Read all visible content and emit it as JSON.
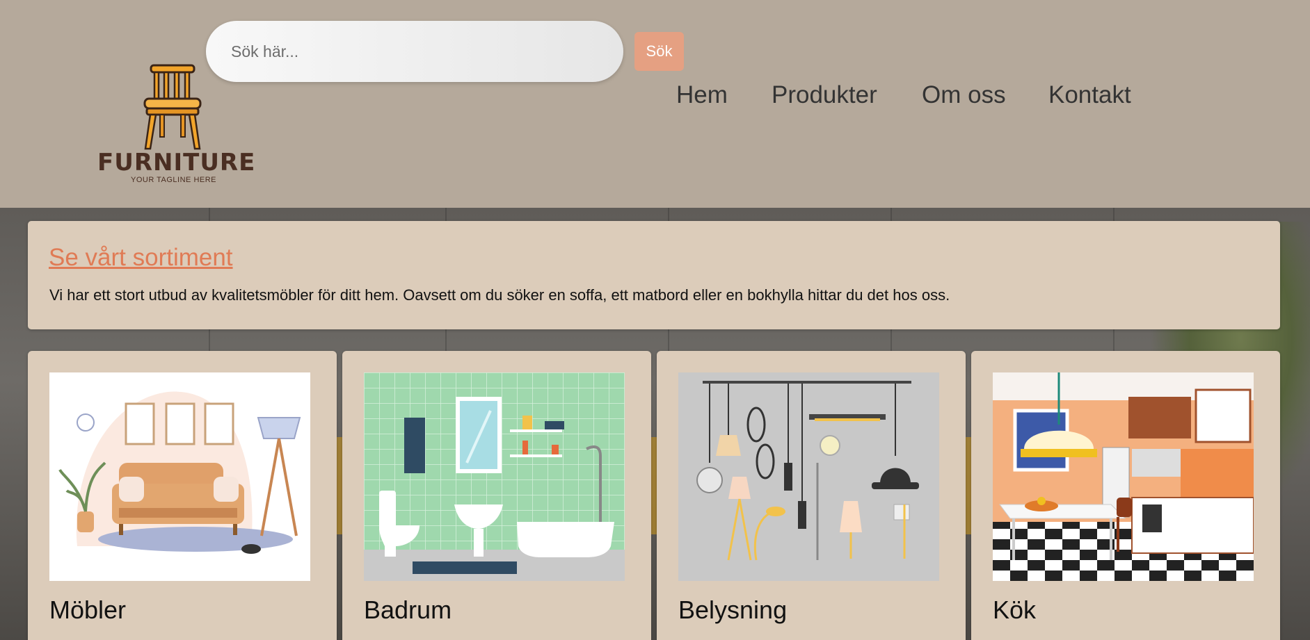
{
  "header": {
    "logo": {
      "word": "FURNITURE",
      "tagline": "YOUR TAGLINE HERE"
    },
    "search": {
      "placeholder": "Sök här...",
      "value": "",
      "button_label": "Sök"
    },
    "nav": [
      {
        "label": "Hem"
      },
      {
        "label": "Produkter"
      },
      {
        "label": "Om oss"
      },
      {
        "label": "Kontakt"
      }
    ]
  },
  "intro": {
    "title": "Se vårt sortiment",
    "text": "Vi har ett stort utbud av kvalitetsmöbler för ditt hem. Oavsett om du söker en soffa, ett matbord eller en bokhylla hittar du det hos oss."
  },
  "categories": [
    {
      "label": "Möbler",
      "image": "living-room-illustration"
    },
    {
      "label": "Badrum",
      "image": "bathroom-illustration"
    },
    {
      "label": "Belysning",
      "image": "lamps-illustration"
    },
    {
      "label": "Kök",
      "image": "kitchen-illustration"
    }
  ],
  "colors": {
    "header_bg": "#b5a99b",
    "panel_bg": "#dcccba",
    "accent": "#e07b55",
    "search_button": "#e5a082",
    "logo_brown": "#4a2e22"
  }
}
